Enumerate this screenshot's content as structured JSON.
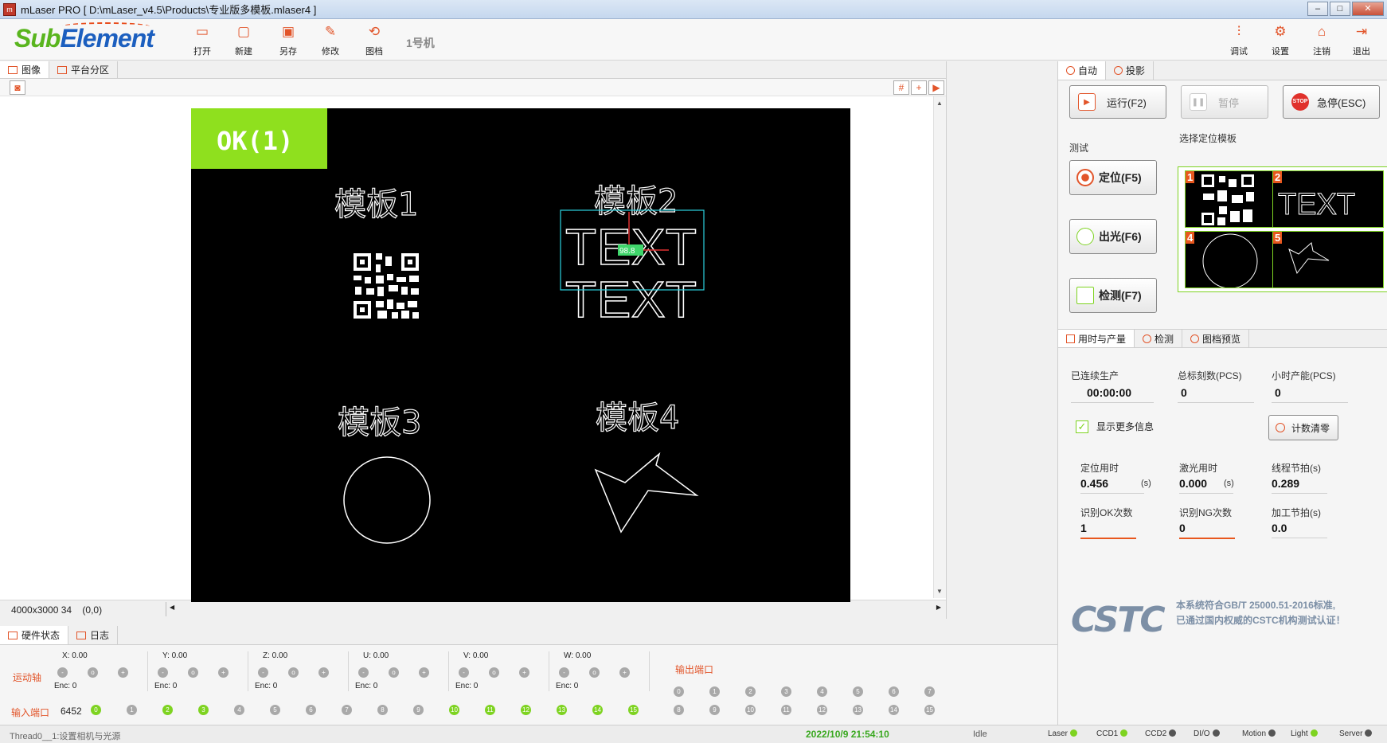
{
  "window": {
    "title": "mLaser PRO  [ D:\\mLaser_v4.5\\Products\\专业版多模板.mlaser4 ]",
    "controls": [
      "–",
      "□",
      "✕"
    ]
  },
  "logo": {
    "sub": "Sub",
    "element": "Element"
  },
  "toolbar": {
    "left": [
      {
        "label": "打开",
        "icon": "folder-open-icon"
      },
      {
        "label": "新建",
        "icon": "new-file-icon"
      },
      {
        "label": "另存",
        "icon": "save-as-icon"
      },
      {
        "label": "修改",
        "icon": "edit-icon"
      },
      {
        "label": "图档",
        "icon": "graphic-file-icon"
      }
    ],
    "machine": "1号机",
    "right": [
      {
        "label": "调试",
        "icon": "sliders-icon"
      },
      {
        "label": "设置",
        "icon": "gear-icon"
      },
      {
        "label": "注销",
        "icon": "logout-house-icon"
      },
      {
        "label": "退出",
        "icon": "exit-icon"
      }
    ]
  },
  "image_panel": {
    "tabs": [
      "图像",
      "平台分区"
    ],
    "ok_badge": "OK(1)",
    "templates": [
      "模板1",
      "模板2",
      "模板3",
      "模板4"
    ],
    "match_score": "98.8",
    "text_sample": "TEXT",
    "resolution": "4000x3000 34",
    "coords": "(0,0)"
  },
  "right_panel": {
    "tabs": [
      "自动",
      "投影"
    ],
    "buttons": {
      "run": "运行(F2)",
      "pause": "暂停",
      "estop": "急停(ESC)",
      "stop_badge": "STOP"
    },
    "test_label": "测试",
    "select_template_label": "选择定位模板",
    "locate": "定位(F5)",
    "laser": "出光(F6)",
    "detect": "检测(F7)",
    "thumb_numbers": [
      "1",
      "2",
      "4",
      "5"
    ],
    "stat_tabs": [
      "用时与产量",
      "检测",
      "图档预览"
    ],
    "stats": {
      "continuous_label": "已连续生产",
      "continuous_value": "00:00:00",
      "total_label": "总标刻数(PCS)",
      "total_value": "0",
      "hourly_label": "小时产能(PCS)",
      "hourly_value": "0",
      "show_more": "显示更多信息",
      "reset_count": "计数清零",
      "locate_time_label": "定位用时",
      "locate_time_value": "0.456",
      "locate_time_unit": "(s)",
      "laser_time_label": "激光用时",
      "laser_time_value": "0.000",
      "laser_time_unit": "(s)",
      "thread_tact_label": "线程节拍(s)",
      "thread_tact_value": "0.289",
      "ok_count_label": "识别OK次数",
      "ok_count_value": "1",
      "ng_count_label": "识别NG次数",
      "ng_count_value": "0",
      "process_tact_label": "加工节拍(s)",
      "process_tact_value": "0.0"
    },
    "cstc_logo": "CSTC",
    "cstc_line1": "本系统符合GB/T 25000.51-2016标准,",
    "cstc_line2": "已通过国内权威的CSTC机构测试认证！"
  },
  "hardware": {
    "tabs": [
      "硬件状态",
      "日志"
    ],
    "axis_label": "运动轴",
    "axes": [
      {
        "name": "X:",
        "value": "0.00",
        "enc": "Enc:",
        "enc_value": "0"
      },
      {
        "name": "Y:",
        "value": "0.00",
        "enc": "Enc:",
        "enc_value": "0"
      },
      {
        "name": "Z:",
        "value": "0.00",
        "enc": "Enc:",
        "enc_value": "0"
      },
      {
        "name": "U:",
        "value": "0.00",
        "enc": "Enc:",
        "enc_value": "0"
      },
      {
        "name": "V:",
        "value": "0.00",
        "enc": "Enc:",
        "enc_value": "0"
      },
      {
        "name": "W:",
        "value": "0.00",
        "enc": "Enc:",
        "enc_value": "0"
      }
    ],
    "axis_dot_glyphs": [
      "-",
      "o",
      "+"
    ],
    "input_label": "输入端口",
    "input_count": "6452",
    "inputs_on": [
      0,
      2,
      3,
      10,
      11,
      12,
      13,
      14,
      15
    ],
    "output_label": "输出端口",
    "port_numbers": [
      "0",
      "1",
      "2",
      "3",
      "4",
      "5",
      "6",
      "7",
      "8",
      "9",
      "10",
      "11",
      "12",
      "13",
      "14",
      "15"
    ]
  },
  "statusbar": {
    "thread": "Thread0__1:设置相机与光源",
    "time": "2022/10/9 21:54:10",
    "state": "Idle",
    "indicators": [
      {
        "name": "Laser",
        "color": "#7ed321"
      },
      {
        "name": "CCD1",
        "color": "#7ed321"
      },
      {
        "name": "CCD2",
        "color": "#555555"
      },
      {
        "name": "DI/O",
        "color": "#555555"
      },
      {
        "name": "Motion",
        "color": "#555555"
      },
      {
        "name": "Light",
        "color": "#7ed321"
      },
      {
        "name": "Server",
        "color": "#555555"
      }
    ]
  },
  "colors": {
    "accent": "#e2552a",
    "ok_green": "#8fe01e",
    "status_green": "#7ed321"
  }
}
